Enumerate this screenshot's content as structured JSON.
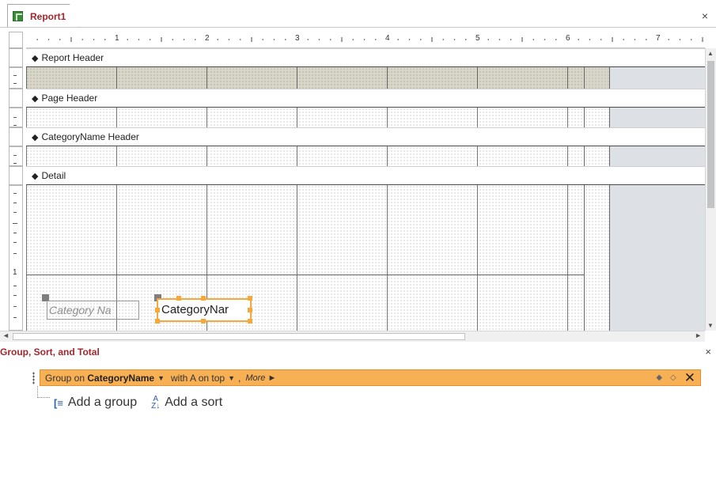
{
  "document_tab": {
    "title": "Report1",
    "icon": "report-icon",
    "close_label": "×"
  },
  "ruler": {
    "numbers": [
      "1",
      "2",
      "3",
      "4",
      "5",
      "6",
      "7"
    ]
  },
  "sections": {
    "report_header": "Report Header",
    "page_header": "Page Header",
    "group_header": "CategoryName Header",
    "detail": "Detail"
  },
  "vertical_ruler": {
    "number": "1"
  },
  "controls": {
    "label_text": "Category Na",
    "textbox_text": "CategoryNar"
  },
  "group_sort_total": {
    "title": "Group, Sort, and Total",
    "close_label": "×",
    "group_row": {
      "prefix": "Group on",
      "field": "CategoryName",
      "order": "with A on top",
      "separator": ",",
      "more": "More ►"
    },
    "add_group": "Add a group",
    "add_sort": "Add a sort"
  },
  "colors": {
    "accent_red": "#a4262c",
    "group_row_orange": "#f8b055",
    "selection_orange": "#f5a93a",
    "header_fill": "#d8d6c8"
  }
}
